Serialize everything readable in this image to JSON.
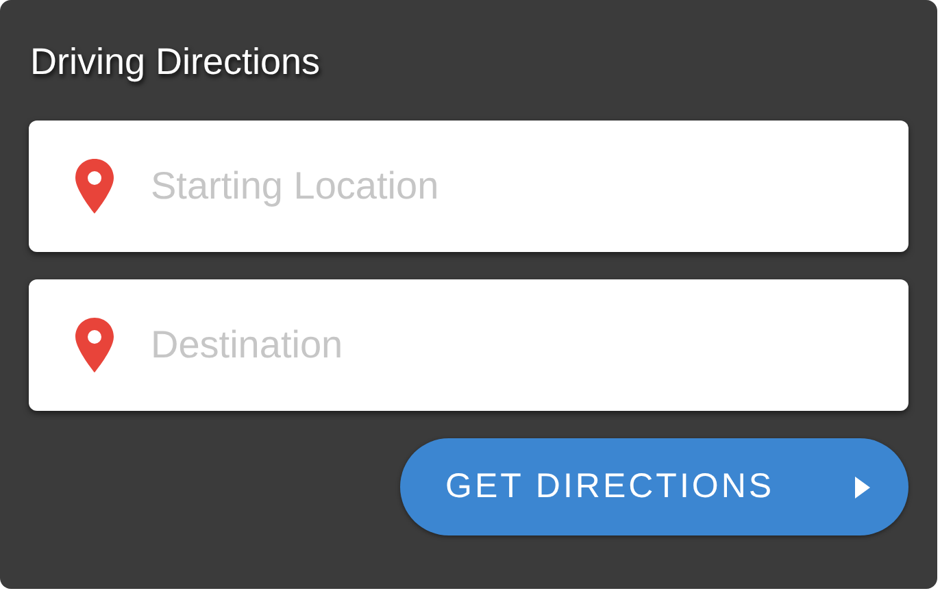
{
  "title": "Driving Directions",
  "fields": [
    {
      "placeholder": "Starting Location"
    },
    {
      "placeholder": "Destination"
    }
  ],
  "button": {
    "label": "GET DIRECTIONS"
  }
}
